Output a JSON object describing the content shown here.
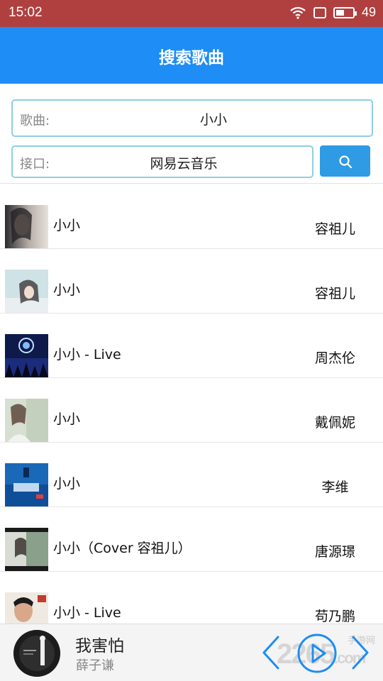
{
  "status_bar": {
    "time": "15:02",
    "battery": "49",
    "battery_level": 0.49
  },
  "app_bar": {
    "title": "搜索歌曲"
  },
  "search": {
    "label": "歌曲:",
    "value": "小小"
  },
  "api": {
    "label": "接口:",
    "value": "网易云音乐"
  },
  "songs": [
    {
      "name": "小小",
      "artist": "容祖儿"
    },
    {
      "name": "小小",
      "artist": "容祖儿"
    },
    {
      "name": "小小 - Live",
      "artist": "周杰伦"
    },
    {
      "name": "小小",
      "artist": "戴佩妮"
    },
    {
      "name": "小小",
      "artist": "李维"
    },
    {
      "name": "小小（Cover 容祖儿）",
      "artist": "唐源璟"
    },
    {
      "name": "小小 - Live",
      "artist": "苟乃鹏"
    }
  ],
  "player": {
    "title": "我害怕",
    "artist": "薛子谦"
  },
  "watermark": {
    "main": "2265",
    "suffix": ".com",
    "small": "手游网"
  },
  "colors": {
    "app_bar": "#1e8df5",
    "status_bar": "#b04040",
    "search_button": "#2e9be4",
    "player_accent": "#1e8df5"
  }
}
